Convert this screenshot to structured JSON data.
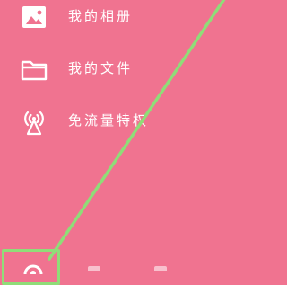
{
  "menu": {
    "items": [
      {
        "label": "我的相册",
        "icon": "photo-album-icon"
      },
      {
        "label": "我的文件",
        "icon": "folder-icon"
      },
      {
        "label": "免流量特权",
        "icon": "broadcast-tower-icon"
      }
    ]
  },
  "bottom_bar": {
    "icons": [
      "settings-icon"
    ]
  },
  "annotation": {
    "highlight_color": "#8fdd78",
    "arrow_color": "#8fdd78"
  },
  "colors": {
    "background": "#f07390",
    "text": "#ffffff"
  }
}
